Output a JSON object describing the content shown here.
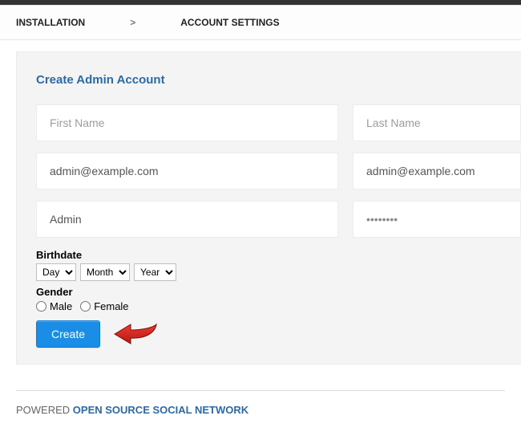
{
  "breadcrumb": {
    "step1": "INSTALLATION",
    "sep": ">",
    "step2": "ACCOUNT SETTINGS"
  },
  "panel": {
    "title": "Create Admin Account",
    "first_name_placeholder": "First Name",
    "last_name_placeholder": "Last Name",
    "email_value": "admin@example.com",
    "email_confirm_value": "admin@example.com",
    "username_value": "Admin",
    "password_value": "••••••••",
    "birthdate_label": "Birthdate",
    "birthdate_day_label": "Day",
    "birthdate_month_label": "Month",
    "birthdate_year_label": "Year",
    "gender_label": "Gender",
    "gender_male": "Male",
    "gender_female": "Female",
    "create_button": "Create"
  },
  "footer": {
    "prefix": "POWERED ",
    "link": "OPEN SOURCE SOCIAL NETWORK"
  }
}
